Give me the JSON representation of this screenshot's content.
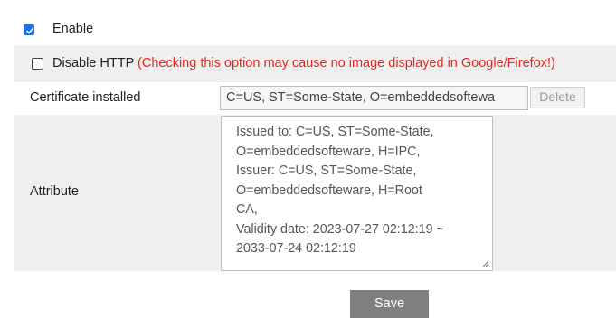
{
  "enable": {
    "label": "Enable",
    "checked": true
  },
  "disable_http": {
    "label": "Disable HTTP",
    "warning": "(Checking this option may cause no image displayed in Google/Firefox!)",
    "checked": false
  },
  "certificate": {
    "label": "Certificate installed",
    "value": "C=US, ST=Some-State, O=embeddedsoftewa",
    "delete_label": "Delete"
  },
  "attribute": {
    "label": "Attribute",
    "lines": [
      "Issued to: C=US, ST=Some-State,",
      "O=embeddedsofteware, H=IPC,",
      "Issuer: C=US, ST=Some-State,",
      "O=embeddedsofteware, H=Root",
      "CA,",
      "Validity date: 2023-07-27 02:12:19 ~",
      "2033-07-24 02:12:19"
    ]
  },
  "save_label": "Save",
  "colors": {
    "accent": "#1a73e8",
    "warning": "#e8261d",
    "row_alt": "#efefef",
    "save_bg": "#7f7f7f"
  }
}
